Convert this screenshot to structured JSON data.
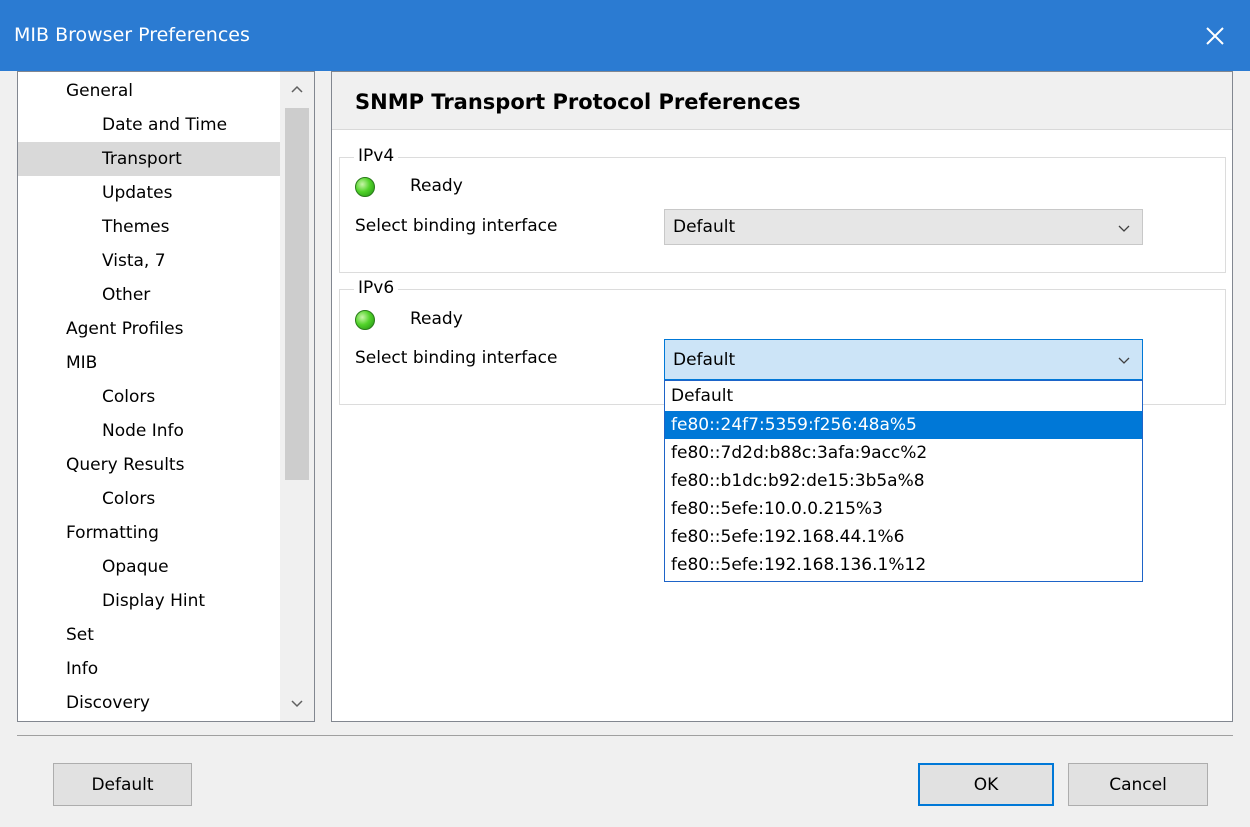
{
  "window": {
    "title": "MIB Browser Preferences"
  },
  "tree": {
    "items": [
      {
        "label": "General",
        "level": 0
      },
      {
        "label": "Date and Time",
        "level": 1
      },
      {
        "label": "Transport",
        "level": 1,
        "selected": true
      },
      {
        "label": "Updates",
        "level": 1
      },
      {
        "label": "Themes",
        "level": 1
      },
      {
        "label": "Vista, 7",
        "level": 1
      },
      {
        "label": "Other",
        "level": 1
      },
      {
        "label": "Agent Profiles",
        "level": 0
      },
      {
        "label": "MIB",
        "level": 0
      },
      {
        "label": "Colors",
        "level": 1
      },
      {
        "label": "Node Info",
        "level": 1
      },
      {
        "label": "Query Results",
        "level": 0
      },
      {
        "label": "Colors",
        "level": 1
      },
      {
        "label": "Formatting",
        "level": 0
      },
      {
        "label": "Opaque",
        "level": 1
      },
      {
        "label": "Display Hint",
        "level": 1
      },
      {
        "label": "Set",
        "level": 0
      },
      {
        "label": "Info",
        "level": 0
      },
      {
        "label": "Discovery",
        "level": 0
      }
    ]
  },
  "panel": {
    "title": "SNMP Transport Protocol Preferences",
    "ipv4": {
      "legend": "IPv4",
      "status": "Ready",
      "binding_label": "Select binding interface",
      "binding_value": "Default"
    },
    "ipv6": {
      "legend": "IPv6",
      "status": "Ready",
      "binding_label": "Select binding interface",
      "binding_value": "Default",
      "options": [
        "Default",
        "fe80::24f7:5359:f256:48a%5",
        "fe80::7d2d:b88c:3afa:9acc%2",
        "fe80::b1dc:b92:de15:3b5a%8",
        "fe80::5efe:10.0.0.215%3",
        "fe80::5efe:192.168.44.1%6",
        "fe80::5efe:192.168.136.1%12"
      ],
      "highlighted_option": "fe80::24f7:5359:f256:48a%5"
    }
  },
  "buttons": {
    "default_label": "Default",
    "ok_label": "OK",
    "cancel_label": "Cancel"
  },
  "colors": {
    "titlebar": "#2b7bd2",
    "selection": "#0078d7",
    "status_ready": "#52d32a"
  }
}
